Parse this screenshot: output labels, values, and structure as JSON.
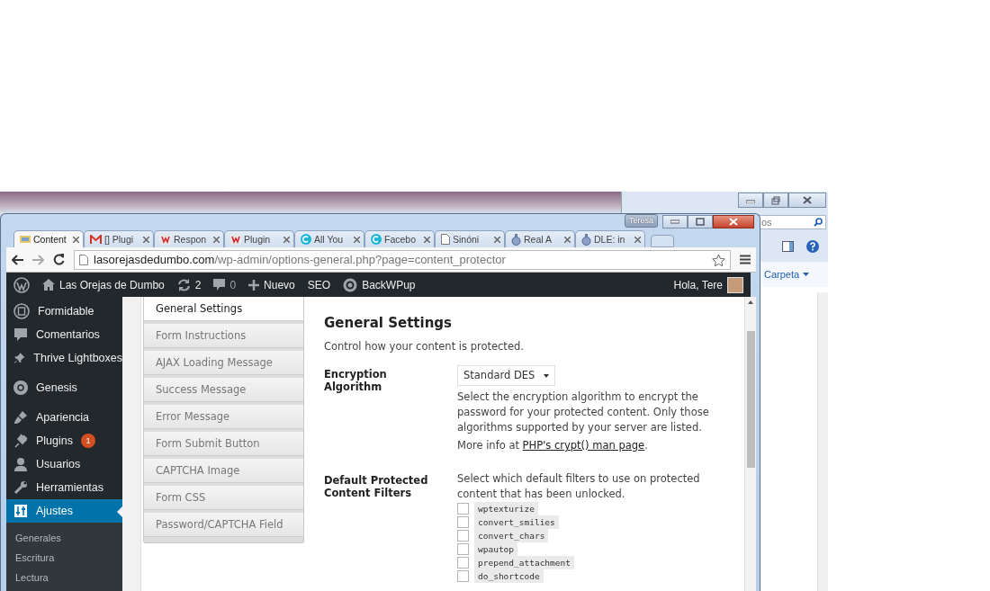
{
  "explorer": {
    "search_text": "os",
    "menu": "Carpeta"
  },
  "browser": {
    "profile": "Teresa",
    "tabs": [
      {
        "title": "Content",
        "kind": "site",
        "selected": true
      },
      {
        "title": "[] Plugi",
        "kind": "gmail",
        "selected": false
      },
      {
        "title": "Respon",
        "kind": "w",
        "selected": false
      },
      {
        "title": "Plugin",
        "kind": "w",
        "selected": false
      },
      {
        "title": "All You",
        "kind": "c",
        "selected": false
      },
      {
        "title": "Facebo",
        "kind": "c",
        "selected": false
      },
      {
        "title": "Sinóni",
        "kind": "page",
        "selected": false
      },
      {
        "title": "Real A",
        "kind": "medal",
        "selected": false
      },
      {
        "title": "DLE: in",
        "kind": "medal",
        "selected": false
      }
    ],
    "address": {
      "domain": "lasorejasdedumbo.com",
      "path": "/wp-admin/options-general.php?page=content_protector"
    }
  },
  "admin_bar": {
    "site": "Las Orejas de Dumbo",
    "updates": "2",
    "comments": "0",
    "new": "Nuevo",
    "seo": "SEO",
    "backup": "BackWPup",
    "greeting": "Hola, Tere"
  },
  "sidebar": {
    "groups": [
      [
        {
          "label": "Formidable",
          "kind": "form",
          "selected": false
        },
        {
          "label": "Comentarios",
          "kind": "comment",
          "selected": false
        },
        {
          "label": "Thrive Lightboxes",
          "kind": "pin",
          "selected": false
        }
      ],
      [
        {
          "label": "Genesis",
          "kind": "genesis",
          "selected": false
        }
      ],
      [
        {
          "label": "Apariencia",
          "kind": "brush",
          "selected": false
        },
        {
          "label": "Plugins",
          "kind": "plug",
          "selected": false,
          "badge": "1"
        },
        {
          "label": "Usuarios",
          "kind": "user",
          "selected": false
        },
        {
          "label": "Herramientas",
          "kind": "wrench",
          "selected": false
        },
        {
          "label": "Ajustes",
          "kind": "settings",
          "selected": true
        }
      ]
    ],
    "submenu": [
      "Generales",
      "Escritura",
      "Lectura"
    ]
  },
  "settings_tabs": [
    {
      "label": "General Settings",
      "selected": true
    },
    {
      "label": "Form Instructions",
      "selected": false
    },
    {
      "label": "AJAX Loading Message",
      "selected": false
    },
    {
      "label": "Success Message",
      "selected": false
    },
    {
      "label": "Error Message",
      "selected": false
    },
    {
      "label": "Form Submit Button",
      "selected": false
    },
    {
      "label": "CAPTCHA Image",
      "selected": false
    },
    {
      "label": "Form CSS",
      "selected": false
    },
    {
      "label": "Password/CAPTCHA Field",
      "selected": false
    }
  ],
  "page": {
    "title": "General Settings",
    "intro": "Control how your content is protected.",
    "encryption": {
      "label": "Encryption Algorithm",
      "value": "Standard DES",
      "description": "Select the encryption algorithm to encrypt the password for your protected content. Only those algorithms supported by your server are listed.",
      "more_prefix": "More info at ",
      "more_link": "PHP's crypt() man page",
      "more_suffix": "."
    },
    "filters": {
      "label": "Default Protected Content Filters",
      "description": "Select which default filters to use on protected content that has been unlocked.",
      "options": [
        {
          "name": "wptexturize",
          "checked": false
        },
        {
          "name": "convert_smilies",
          "checked": false
        },
        {
          "name": "convert_chars",
          "checked": false
        },
        {
          "name": "wpautop",
          "checked": false
        },
        {
          "name": "prepend_attachment",
          "checked": false
        },
        {
          "name": "do_shortcode",
          "checked": false
        }
      ]
    }
  }
}
